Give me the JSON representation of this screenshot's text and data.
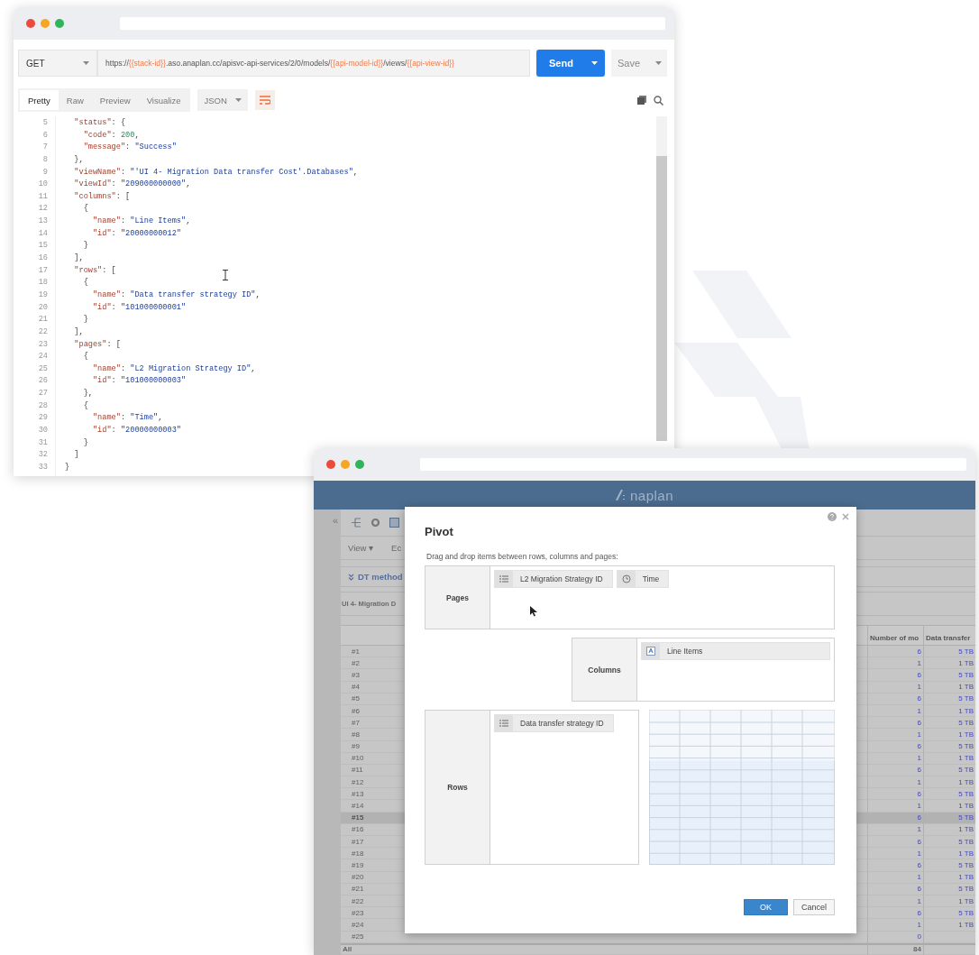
{
  "api_client": {
    "method": "GET",
    "url": [
      {
        "kind": "text",
        "text": "https://"
      },
      {
        "kind": "variable",
        "text": "{{stack-id}}"
      },
      {
        "kind": "text",
        "text": ".aso.anaplan.cc/apisvc-api-services/2/0/models/"
      },
      {
        "kind": "variable",
        "text": "{{api-model-id}}"
      },
      {
        "kind": "text",
        "text": "/views/"
      },
      {
        "kind": "variable",
        "text": "{{api-view-id}}"
      }
    ],
    "send": "Send",
    "save": "Save",
    "view_tabs": [
      {
        "label": "Pretty",
        "selected": true
      },
      {
        "label": "Raw",
        "selected": false
      },
      {
        "label": "Preview",
        "selected": false
      },
      {
        "label": "Visualize",
        "selected": false
      }
    ],
    "format": "JSON",
    "code_lines": [
      {
        "number": "5",
        "text": "  \"status\": {"
      },
      {
        "number": "6",
        "text": "    \"code\": 200,"
      },
      {
        "number": "7",
        "text": "    \"message\": \"Success\""
      },
      {
        "number": "8",
        "text": "  },"
      },
      {
        "number": "9",
        "text": "  \"viewName\": \"'UI 4- Migration Data transfer Cost'.Databases\","
      },
      {
        "number": "10",
        "text": "  \"viewId\": \"209000000000\","
      },
      {
        "number": "11",
        "text": "  \"columns\": ["
      },
      {
        "number": "12",
        "text": "    {"
      },
      {
        "number": "13",
        "text": "      \"name\": \"Line Items\","
      },
      {
        "number": "14",
        "text": "      \"id\": \"20000000012\""
      },
      {
        "number": "15",
        "text": "    }"
      },
      {
        "number": "16",
        "text": "  ],"
      },
      {
        "number": "17",
        "text": "  \"rows\": ["
      },
      {
        "number": "18",
        "text": "    {"
      },
      {
        "number": "19",
        "text": "      \"name\": \"Data transfer strategy ID\","
      },
      {
        "number": "20",
        "text": "      \"id\": \"101000000001\""
      },
      {
        "number": "21",
        "text": "    }"
      },
      {
        "number": "22",
        "text": "  ],"
      },
      {
        "number": "23",
        "text": "  \"pages\": ["
      },
      {
        "number": "24",
        "text": "    {"
      },
      {
        "number": "25",
        "text": "      \"name\": \"L2 Migration Strategy ID\","
      },
      {
        "number": "26",
        "text": "      \"id\": \"101000000003\""
      },
      {
        "number": "27",
        "text": "    },"
      },
      {
        "number": "28",
        "text": "    {"
      },
      {
        "number": "29",
        "text": "      \"name\": \"Time\","
      },
      {
        "number": "30",
        "text": "      \"id\": \"20000000003\""
      },
      {
        "number": "31",
        "text": "    }"
      },
      {
        "number": "32",
        "text": "  ]"
      },
      {
        "number": "33",
        "text": "}"
      }
    ]
  },
  "anaplan": {
    "logo_text": "naplan",
    "collapse": "«",
    "menu": "View ▾",
    "menu_cut": "Ec",
    "filter": "DT method",
    "view_title": "UI 4- Migration D",
    "table": {
      "columns": [
        "Number of mo",
        "Data transfer"
      ],
      "rows": [
        {
          "label": "#1",
          "values": [
            "6",
            "5 TB"
          ],
          "selected": false
        },
        {
          "label": "#2",
          "values": [
            "1",
            "1 TB"
          ],
          "selected": false
        },
        {
          "label": "#3",
          "values": [
            "6",
            "5 TB"
          ],
          "selected": false
        },
        {
          "label": "#4",
          "values": [
            "1",
            "1 TB"
          ],
          "selected": false
        },
        {
          "label": "#5",
          "values": [
            "6",
            "5 TB"
          ],
          "selected": false
        },
        {
          "label": "#6",
          "values": [
            "1",
            "1 TB"
          ],
          "selected": false
        },
        {
          "label": "#7",
          "values": [
            "6",
            "5 TB"
          ],
          "selected": false
        },
        {
          "label": "#8",
          "values": [
            "1",
            "1 TB"
          ],
          "selected": false
        },
        {
          "label": "#9",
          "values": [
            "6",
            "5 TB"
          ],
          "selected": false
        },
        {
          "label": "#10",
          "values": [
            "1",
            "1 TB"
          ],
          "selected": false
        },
        {
          "label": "#11",
          "values": [
            "6",
            "5 TB"
          ],
          "selected": false
        },
        {
          "label": "#12",
          "values": [
            "1",
            "1 TB"
          ],
          "selected": false
        },
        {
          "label": "#13",
          "values": [
            "6",
            "5 TB"
          ],
          "selected": false
        },
        {
          "label": "#14",
          "values": [
            "1",
            "1 TB"
          ],
          "selected": false
        },
        {
          "label": "#15",
          "values": [
            "6",
            "5 TB"
          ],
          "selected": true
        },
        {
          "label": "#16",
          "values": [
            "1",
            "1 TB"
          ],
          "selected": false
        },
        {
          "label": "#17",
          "values": [
            "6",
            "5 TB"
          ],
          "selected": false
        },
        {
          "label": "#18",
          "values": [
            "1",
            "1 TB"
          ],
          "selected": false
        },
        {
          "label": "#19",
          "values": [
            "6",
            "5 TB"
          ],
          "selected": false
        },
        {
          "label": "#20",
          "values": [
            "1",
            "1 TB"
          ],
          "selected": false
        },
        {
          "label": "#21",
          "values": [
            "6",
            "5 TB"
          ],
          "selected": false
        },
        {
          "label": "#22",
          "values": [
            "1",
            "1 TB"
          ],
          "selected": false
        },
        {
          "label": "#23",
          "values": [
            "6",
            "5 TB"
          ],
          "selected": false
        },
        {
          "label": "#24",
          "values": [
            "1",
            "1 TB"
          ],
          "selected": false
        },
        {
          "label": "#25",
          "values": [
            "0"
          ],
          "selected": false
        }
      ],
      "total": {
        "label": "All",
        "values": [
          "84"
        ]
      }
    },
    "pivot_dialog": {
      "title": "Pivot",
      "instruction": "Drag and drop items between rows, columns and pages:",
      "pages": {
        "label": "Pages",
        "items": [
          {
            "kind": "list",
            "label": "L2 Migration Strategy ID"
          },
          {
            "kind": "time",
            "label": "Time"
          }
        ]
      },
      "columns": {
        "label": "Columns",
        "items": [
          {
            "kind": "lineitems",
            "label": "Line Items"
          }
        ]
      },
      "rows": {
        "label": "Rows",
        "items": [
          {
            "kind": "list",
            "label": "Data transfer strategy ID"
          }
        ]
      },
      "buttons": [
        {
          "label": "OK",
          "kind": "primary"
        },
        {
          "label": "Cancel",
          "kind": "secondary"
        }
      ]
    }
  }
}
